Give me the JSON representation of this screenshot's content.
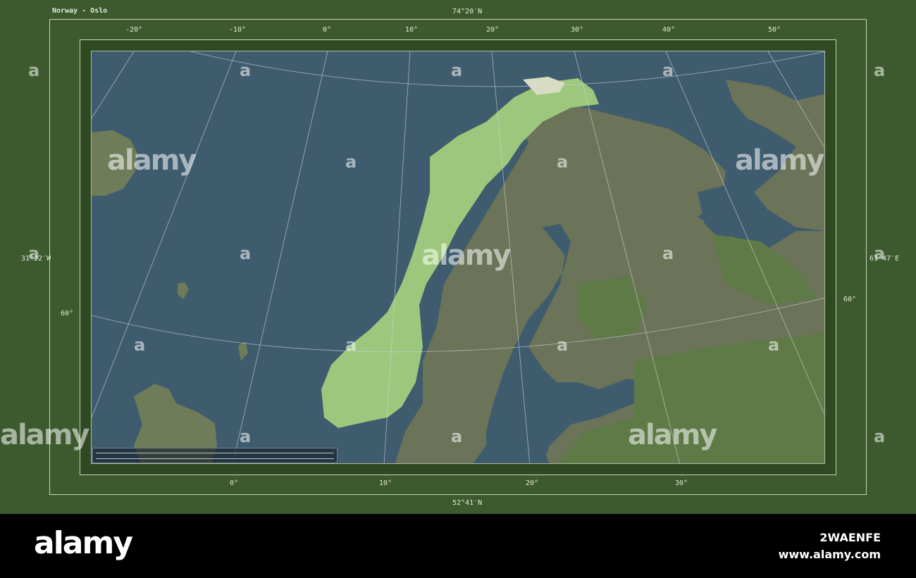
{
  "map": {
    "title": "Norway - Oslo",
    "bounds": {
      "north": "74°20′N",
      "south": "52°41′N",
      "west": "31°22′W",
      "east": "61°47′E"
    },
    "top_ticks": [
      "-20°",
      "-10°",
      "0°",
      "10°",
      "20°",
      "30°",
      "40°",
      "50°"
    ],
    "bottom_ticks": [
      "0°",
      "10°",
      "20°",
      "30°"
    ],
    "left_ticks": [
      "60°"
    ],
    "right_ticks": [
      "60°"
    ],
    "colors": {
      "sea": "#3e5c6e",
      "norway": "#9cc77c",
      "land": "#6b7358",
      "forest": "#5e7a46",
      "frame": "#3d5a2e"
    }
  },
  "watermark": {
    "text": "alamy",
    "letter": "a"
  },
  "footer": {
    "logo": "alamy",
    "image_id": "2WAENFE",
    "url": "www.alamy.com"
  }
}
